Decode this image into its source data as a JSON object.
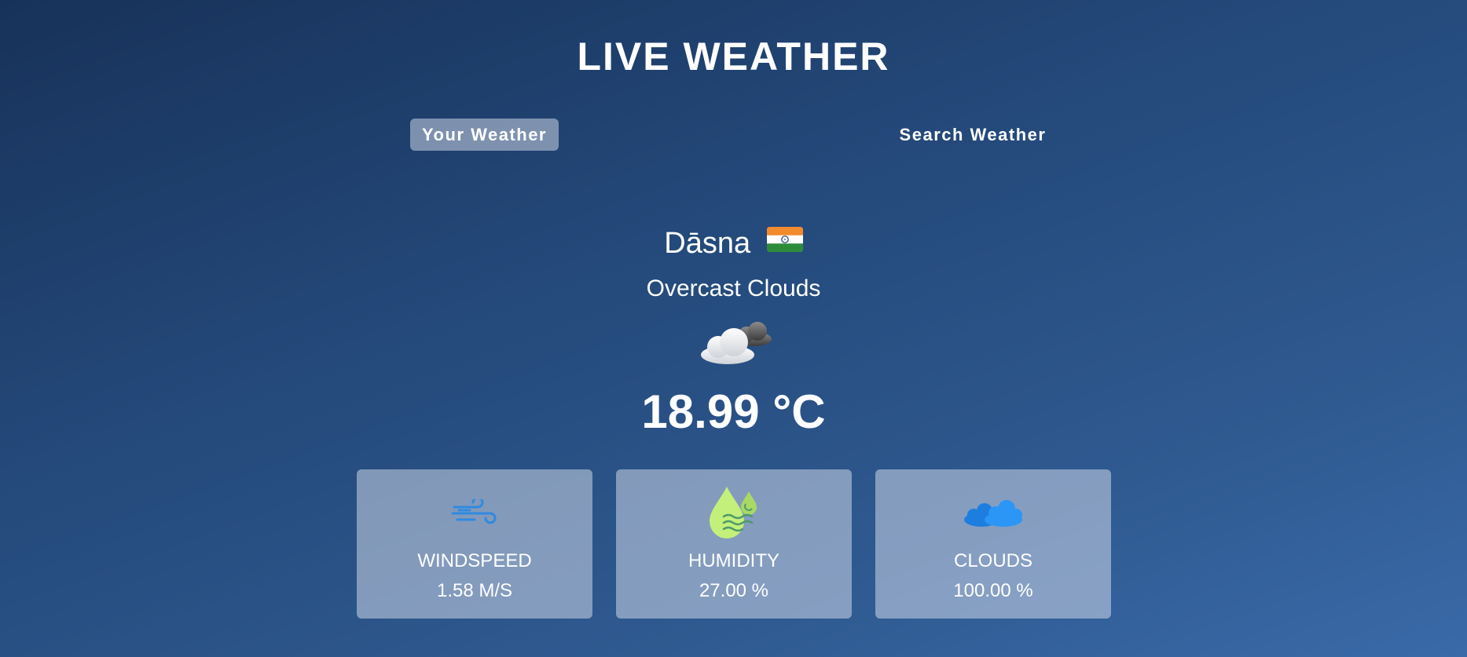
{
  "app": {
    "title": "LIVE WEATHER"
  },
  "tabs": [
    {
      "label": "Your Weather",
      "active": true
    },
    {
      "label": "Search Weather",
      "active": false
    }
  ],
  "weather": {
    "city": "Dāsna",
    "country_flag_icon": "india-flag-icon",
    "description": "Overcast Clouds",
    "condition_icon": "overcast-clouds-icon",
    "temperature": "18.99 °C"
  },
  "stats": [
    {
      "label": "WINDSPEED",
      "value": "1.58 M/S",
      "icon": "wind-icon",
      "icon_color": "#2f8ae0"
    },
    {
      "label": "HUMIDITY",
      "value": "27.00 %",
      "icon": "humidity-drops-icon",
      "icon_color": "#c3f07a"
    },
    {
      "label": "CLOUDS",
      "value": "100.00 %",
      "icon": "clouds-icon",
      "icon_color": "#1e8af0"
    }
  ],
  "colors": {
    "background_top": "#17325a",
    "background_bottom": "#3a6aa8",
    "card_background": "#dbe2ef",
    "text": "#ffffff"
  }
}
